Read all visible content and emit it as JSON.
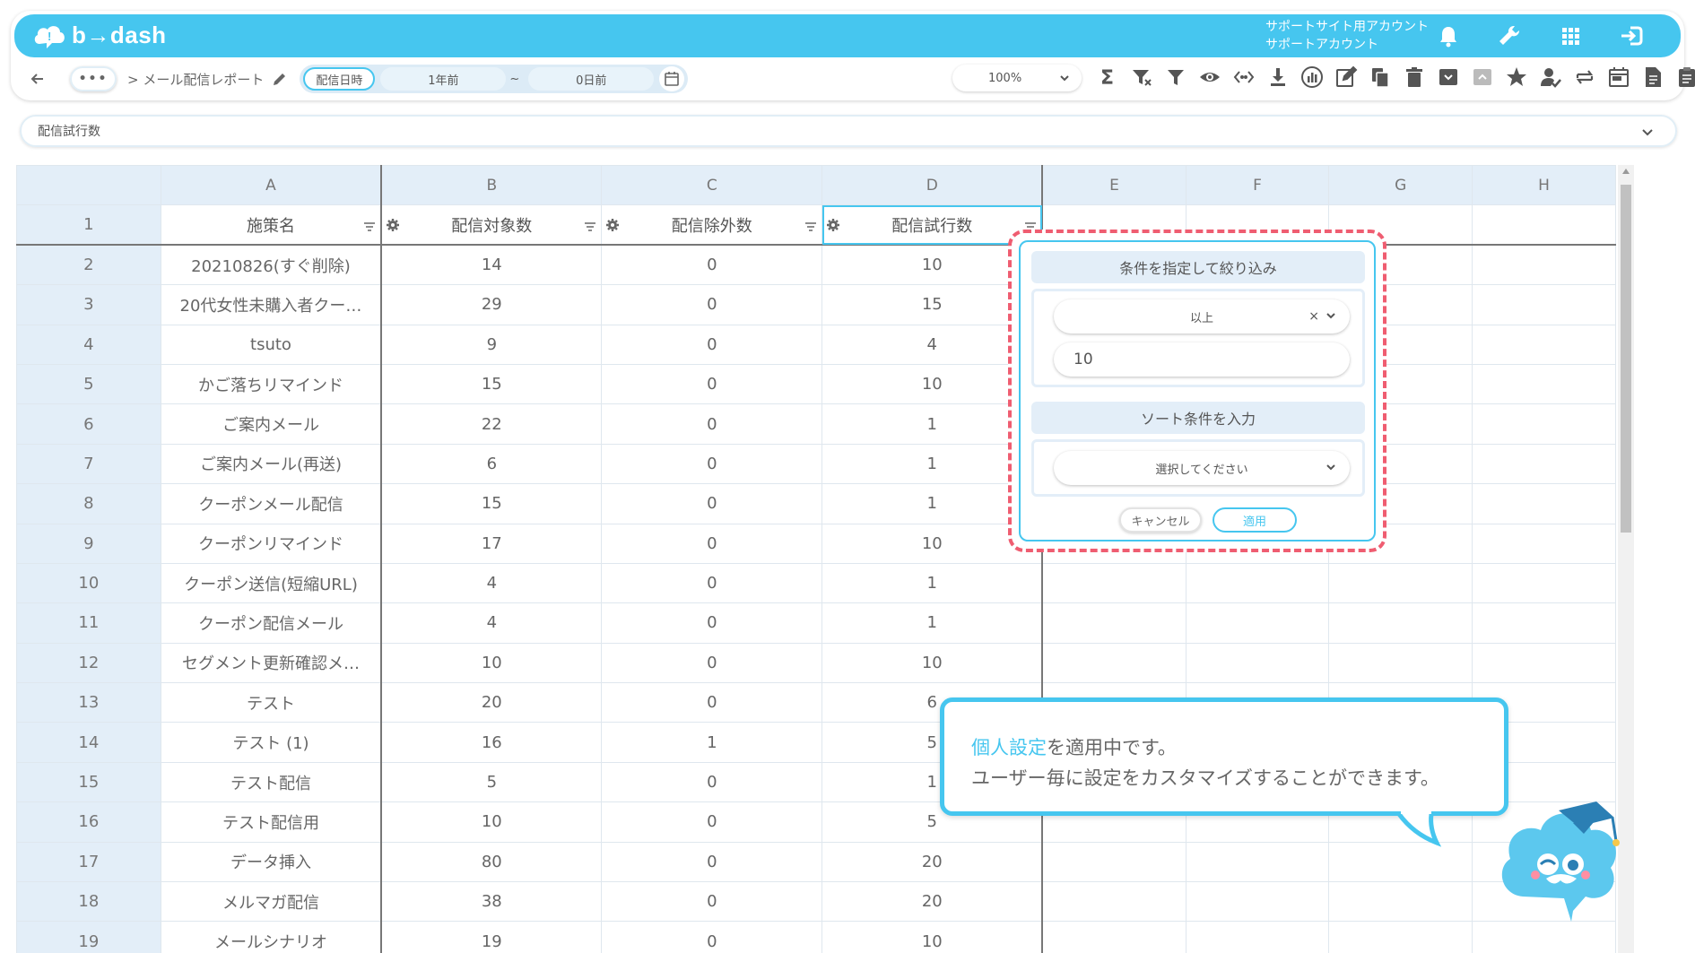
{
  "app": {
    "logo": "b→dash"
  },
  "account": {
    "line1": "サポートサイト用アカウント",
    "line2": "サポートアカウント"
  },
  "toolbar": {
    "dots": "•••",
    "breadcrumb": "> メール配信レポート",
    "date_label": "配信日時",
    "date_from": "1年前",
    "date_sep": "~",
    "date_to": "0日前",
    "zoom": "100%"
  },
  "column_select": {
    "value": "配信試行数"
  },
  "sheet": {
    "columns": [
      "A",
      "B",
      "C",
      "D",
      "E",
      "F",
      "G",
      "H"
    ],
    "header_row": {
      "num": "1",
      "cells": [
        "施策名",
        "配信対象数",
        "配信除外数",
        "配信試行数"
      ]
    },
    "rows": [
      {
        "num": "2",
        "a": "20210826(すぐ削除)",
        "b": "14",
        "c": "0",
        "d": "10"
      },
      {
        "num": "3",
        "a": "20代女性未購入者クー…",
        "b": "29",
        "c": "0",
        "d": "15"
      },
      {
        "num": "4",
        "a": "tsuto",
        "b": "9",
        "c": "0",
        "d": "4"
      },
      {
        "num": "5",
        "a": "かご落ちリマインド",
        "b": "15",
        "c": "0",
        "d": "10"
      },
      {
        "num": "6",
        "a": "ご案内メール",
        "b": "22",
        "c": "0",
        "d": "1"
      },
      {
        "num": "7",
        "a": "ご案内メール(再送)",
        "b": "6",
        "c": "0",
        "d": "1"
      },
      {
        "num": "8",
        "a": "クーポンメール配信",
        "b": "15",
        "c": "0",
        "d": "1"
      },
      {
        "num": "9",
        "a": "クーポンリマインド",
        "b": "17",
        "c": "0",
        "d": "10"
      },
      {
        "num": "10",
        "a": "クーポン送信(短縮URL)",
        "b": "4",
        "c": "0",
        "d": "1"
      },
      {
        "num": "11",
        "a": "クーポン配信メール",
        "b": "4",
        "c": "0",
        "d": "1"
      },
      {
        "num": "12",
        "a": "セグメント更新確認メ…",
        "b": "10",
        "c": "0",
        "d": "10"
      },
      {
        "num": "13",
        "a": "テスト",
        "b": "20",
        "c": "0",
        "d": "6"
      },
      {
        "num": "14",
        "a": "テスト (1)",
        "b": "16",
        "c": "1",
        "d": "5"
      },
      {
        "num": "15",
        "a": "テスト配信",
        "b": "5",
        "c": "0",
        "d": "1"
      },
      {
        "num": "16",
        "a": "テスト配信用",
        "b": "10",
        "c": "0",
        "d": "5"
      },
      {
        "num": "17",
        "a": "データ挿入",
        "b": "80",
        "c": "0",
        "d": "20"
      },
      {
        "num": "18",
        "a": "メルマガ配信",
        "b": "38",
        "c": "0",
        "d": "20"
      },
      {
        "num": "19",
        "a": "メールシナリオ",
        "b": "19",
        "c": "0",
        "d": "10"
      }
    ]
  },
  "filter_popup": {
    "filter_title": "条件を指定して絞り込み",
    "operator": "以上",
    "clear": "×",
    "value": "10",
    "sort_title": "ソート条件を入力",
    "sort_placeholder": "選択してください",
    "cancel": "キャンセル",
    "apply": "適用"
  },
  "notice": {
    "link": "個人設定",
    "line1_rest": "を適用中です。",
    "line2": "ユーザー毎に設定をカスタマイズすることができます。"
  },
  "colors": {
    "accent": "#46c6ef",
    "highlight_dash": "#ef5d71",
    "header_bg": "#e3eef8"
  }
}
